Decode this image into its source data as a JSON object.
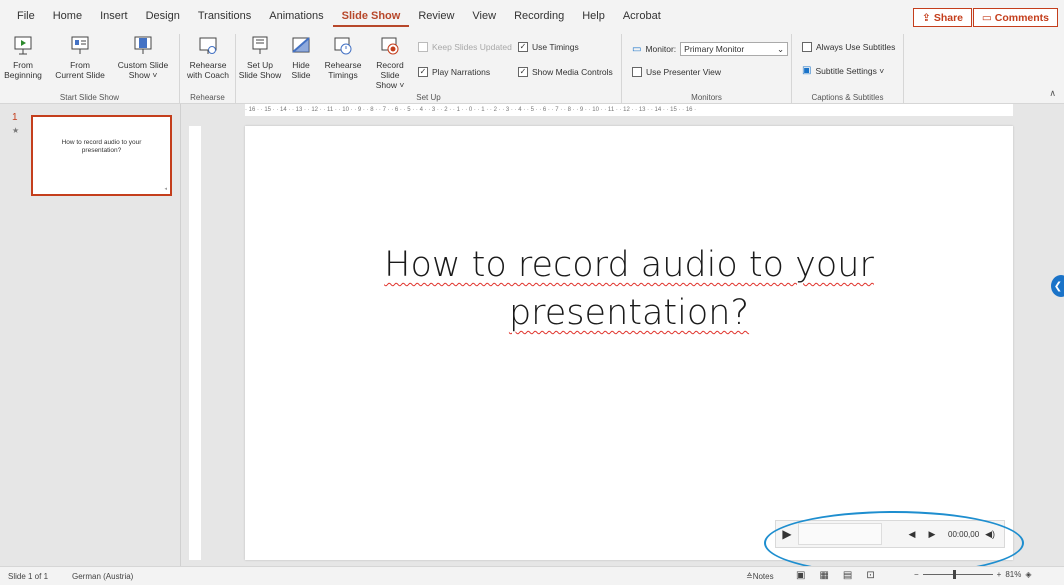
{
  "menu": {
    "tabs": [
      "File",
      "Home",
      "Insert",
      "Design",
      "Transitions",
      "Animations",
      "Slide Show",
      "Review",
      "View",
      "Recording",
      "Help",
      "Acrobat"
    ],
    "active_tab": "Slide Show",
    "share_label": "Share",
    "comments_label": "Comments"
  },
  "ribbon": {
    "start_slide_show": {
      "label": "Start Slide Show",
      "from_beginning": "From\nBeginning",
      "from_current": "From\nCurrent Slide",
      "custom_show": "Custom Slide\nShow ˅"
    },
    "rehearse": {
      "label": "Rehearse",
      "rehearse_coach": "Rehearse\nwith Coach"
    },
    "set_up": {
      "label": "Set Up",
      "set_up_show": "Set Up\nSlide Show",
      "hide_slide": "Hide\nSlide",
      "rehearse_timings": "Rehearse\nTimings",
      "record_show": "Record Slide\nShow ˅",
      "keep_updated": "Keep Slides Updated",
      "use_timings": "Use Timings",
      "play_narrations": "Play Narrations",
      "show_media_controls": "Show Media Controls"
    },
    "monitors": {
      "label": "Monitors",
      "monitor_label": "Monitor:",
      "monitor_value": "Primary Monitor",
      "presenter_view": "Use Presenter View"
    },
    "captions": {
      "label": "Captions & Subtitles",
      "always_subtitles": "Always Use Subtitles",
      "subtitle_settings": "Subtitle Settings ˅"
    }
  },
  "ruler": {
    "horizontal": "· 16 · · 15 · · 14 · · 13 · · 12 · · 11 · · 10 · · 9 · · 8 · · 7 · · 6 · · 5 · · 4 · · 3 · · 2 · · 1 · · 0 · · 1 · · 2 · · 3 · · 4 · · 5 · · 6 · · 7 · · 8 · · 9 · · 10 · · 11 · · 12 · · 13 · · 14 · · 15 · · 16 ·"
  },
  "thumbnails": [
    {
      "number": "1",
      "text": "How to record audio to your presentation?"
    }
  ],
  "slide": {
    "title_line1": "How to record audio to your",
    "title_line2": "presentation?"
  },
  "media": {
    "time": "00:00,00"
  },
  "status": {
    "slide_info": "Slide 1 of 1",
    "language": "German (Austria)",
    "notes": "Notes",
    "zoom": "81%"
  },
  "colors": {
    "accent": "#c43e1c",
    "highlight_ellipse": "#1e8ecf"
  }
}
